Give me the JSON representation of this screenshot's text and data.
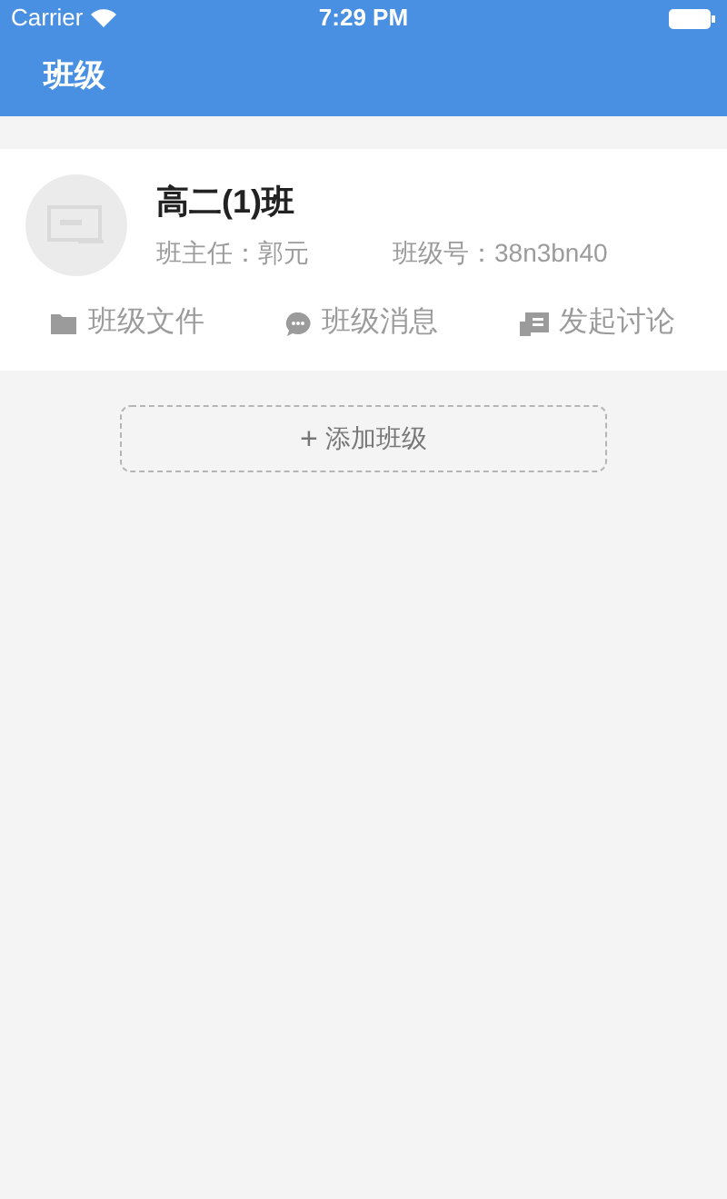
{
  "status_bar": {
    "carrier": "Carrier",
    "time": "7:29 PM"
  },
  "nav_bar": {
    "title": "班级"
  },
  "class_card": {
    "name": "高二(1)班",
    "teacher": "班主任：郭元",
    "class_code": "班级号：38n3bn40",
    "actions": [
      {
        "kind": "folder",
        "label": "班级文件"
      },
      {
        "kind": "chat",
        "label": "班级消息"
      },
      {
        "kind": "discuss",
        "label": "发起讨论"
      }
    ]
  },
  "add_button": {
    "icon": "+",
    "label": "添加班级"
  }
}
